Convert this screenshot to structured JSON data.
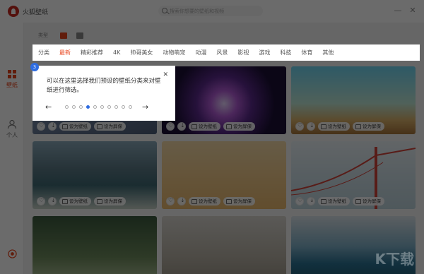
{
  "app": {
    "title": "火狐壁纸"
  },
  "search": {
    "placeholder": "搜索你想要的壁纸和视频"
  },
  "window": {
    "minimize": "—",
    "close": "✕"
  },
  "leftnav": {
    "items": [
      {
        "label": "壁纸",
        "icon": "grid-icon",
        "active": true
      },
      {
        "label": "个人",
        "icon": "user-icon",
        "active": false
      }
    ],
    "bottom_icon": "target-icon"
  },
  "view_toggle": {
    "label": "类型",
    "icons": [
      "image-icon",
      "video-icon"
    ]
  },
  "categories": [
    "分类",
    "最新",
    "精彩推荐",
    "4K",
    "帅哥美女",
    "动物萌宠",
    "动漫",
    "风景",
    "影视",
    "游戏",
    "科技",
    "体育",
    "其他"
  ],
  "active_category": "最新",
  "guide": {
    "step": "3",
    "text": "可以在这里选择我们预设的壁纸分类来对壁纸进行筛选。",
    "close": "✕",
    "prev": "←",
    "next": "→",
    "total_steps": 10,
    "current_step_index": 3
  },
  "thumb_actions": {
    "set_wallpaper": "设为壁纸",
    "set_screensaver": "设为屏保"
  },
  "watermark": "K下载",
  "colors": {
    "accent": "#e8451e",
    "guide_blue": "#2f6de1",
    "logo_red": "#c8291f"
  }
}
